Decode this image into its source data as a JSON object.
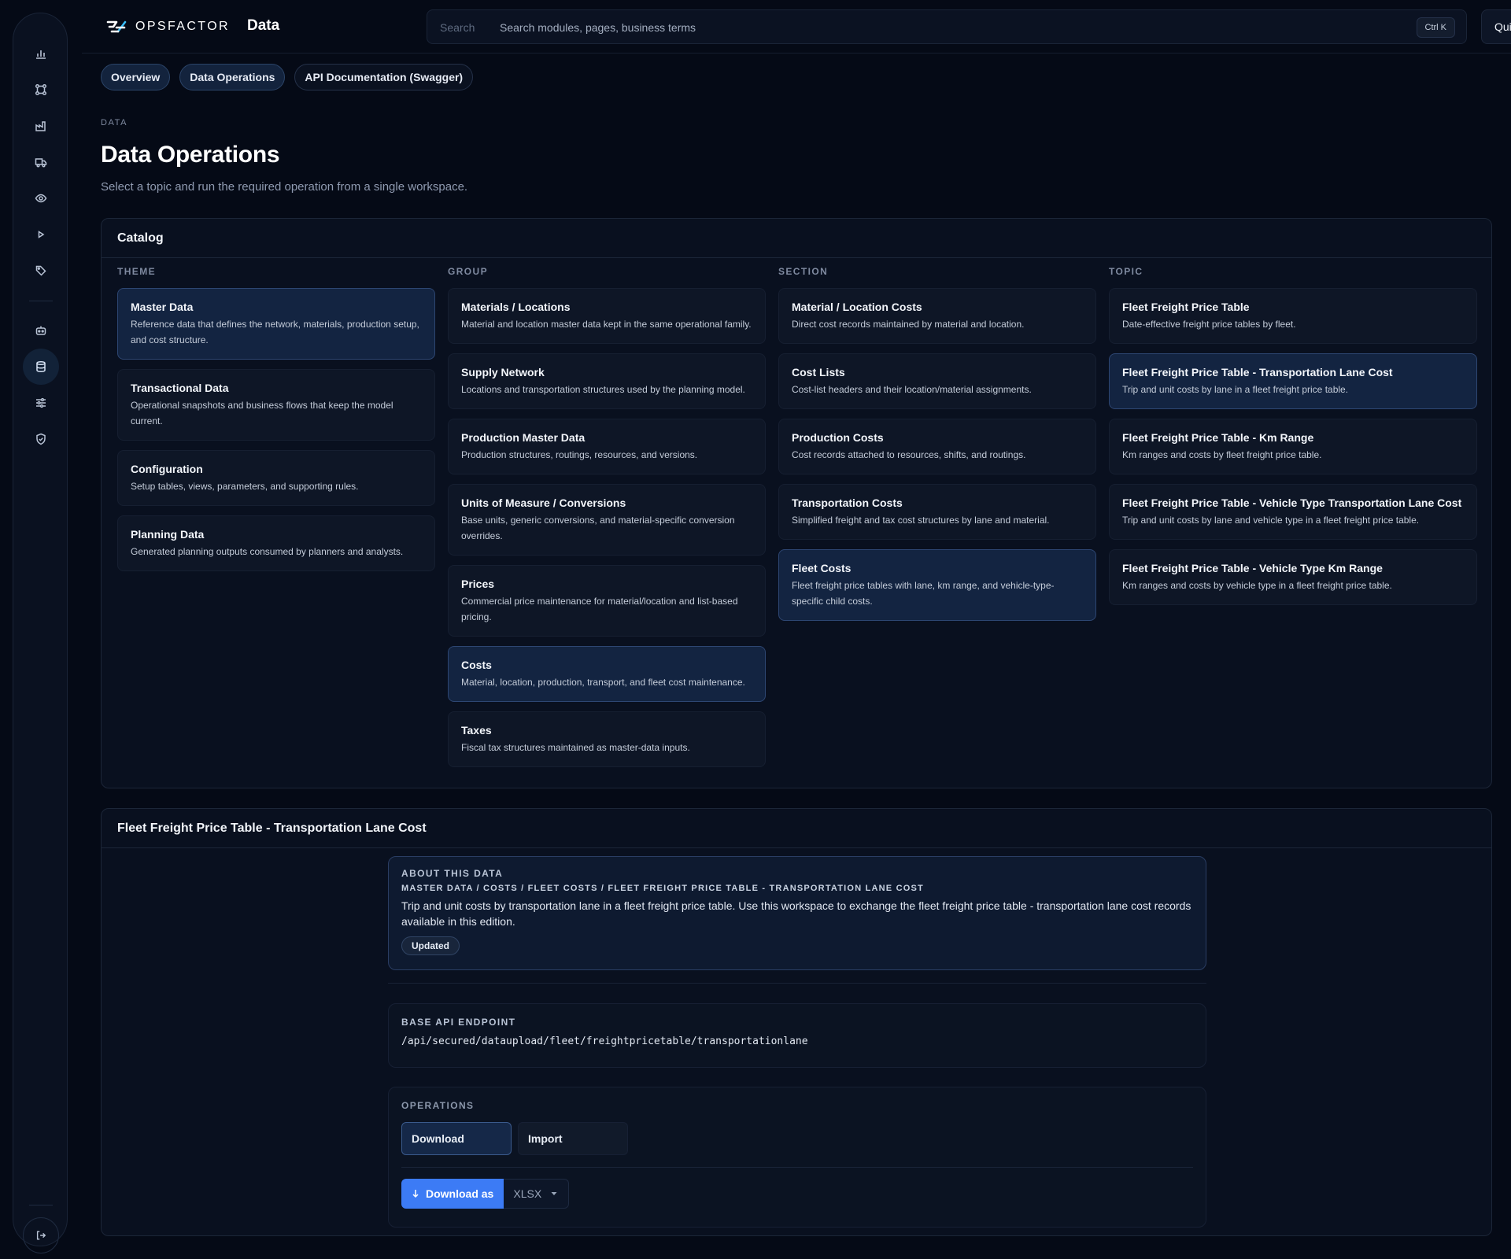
{
  "brand": {
    "name": "OPSFACTOR"
  },
  "header": {
    "title": "Data",
    "search_label": "Search",
    "search_placeholder": "Search modules, pages, business terms",
    "shortcut": "Ctrl K",
    "quick_actions": "Quick actions"
  },
  "sidebar": {
    "icons": [
      "bar-chart-icon",
      "network-icon",
      "factory-icon",
      "truck-icon",
      "eye-icon",
      "play-icon",
      "tag-icon",
      "robot-icon",
      "database-icon",
      "sliders-icon",
      "shield-icon"
    ],
    "active": "database-icon",
    "bottom_icon": "logout-icon"
  },
  "tabs": [
    {
      "label": "Overview",
      "active": true
    },
    {
      "label": "Data Operations",
      "active": true
    },
    {
      "label": "API Documentation (Swagger)",
      "active": false
    }
  ],
  "page": {
    "eyebrow": "DATA",
    "title": "Data Operations",
    "subtitle": "Select a topic and run the required operation from a single workspace."
  },
  "catalog": {
    "title": "Catalog",
    "columns": [
      {
        "header": "THEME",
        "items": [
          {
            "title": "Master Data",
            "desc": "Reference data that defines the network, materials, production setup, and cost structure.",
            "selected": true
          },
          {
            "title": "Transactional Data",
            "desc": "Operational snapshots and business flows that keep the model current.",
            "selected": false
          },
          {
            "title": "Configuration",
            "desc": "Setup tables, views, parameters, and supporting rules.",
            "selected": false
          },
          {
            "title": "Planning Data",
            "desc": "Generated planning outputs consumed by planners and analysts.",
            "selected": false
          }
        ]
      },
      {
        "header": "GROUP",
        "items": [
          {
            "title": "Materials / Locations",
            "desc": "Material and location master data kept in the same operational family.",
            "selected": false
          },
          {
            "title": "Supply Network",
            "desc": "Locations and transportation structures used by the planning model.",
            "selected": false
          },
          {
            "title": "Production Master Data",
            "desc": "Production structures, routings, resources, and versions.",
            "selected": false
          },
          {
            "title": "Units of Measure / Conversions",
            "desc": "Base units, generic conversions, and material-specific conversion overrides.",
            "selected": false
          },
          {
            "title": "Prices",
            "desc": "Commercial price maintenance for material/location and list-based pricing.",
            "selected": false
          },
          {
            "title": "Costs",
            "desc": "Material, location, production, transport, and fleet cost maintenance.",
            "selected": true
          },
          {
            "title": "Taxes",
            "desc": "Fiscal tax structures maintained as master-data inputs.",
            "selected": false
          }
        ]
      },
      {
        "header": "SECTION",
        "items": [
          {
            "title": "Material / Location Costs",
            "desc": "Direct cost records maintained by material and location.",
            "selected": false
          },
          {
            "title": "Cost Lists",
            "desc": "Cost-list headers and their location/material assignments.",
            "selected": false
          },
          {
            "title": "Production Costs",
            "desc": "Cost records attached to resources, shifts, and routings.",
            "selected": false
          },
          {
            "title": "Transportation Costs",
            "desc": "Simplified freight and tax cost structures by lane and material.",
            "selected": false
          },
          {
            "title": "Fleet Costs",
            "desc": "Fleet freight price tables with lane, km range, and vehicle-type-specific child costs.",
            "selected": true
          }
        ]
      },
      {
        "header": "TOPIC",
        "items": [
          {
            "title": "Fleet Freight Price Table",
            "desc": "Date-effective freight price tables by fleet.",
            "selected": false
          },
          {
            "title": "Fleet Freight Price Table - Transportation Lane Cost",
            "desc": "Trip and unit costs by lane in a fleet freight price table.",
            "selected": true
          },
          {
            "title": "Fleet Freight Price Table - Km Range",
            "desc": "Km ranges and costs by fleet freight price table.",
            "selected": false
          },
          {
            "title": "Fleet Freight Price Table - Vehicle Type Transportation Lane Cost",
            "desc": "Trip and unit costs by lane and vehicle type in a fleet freight price table.",
            "selected": false
          },
          {
            "title": "Fleet Freight Price Table - Vehicle Type Km Range",
            "desc": "Km ranges and costs by vehicle type in a fleet freight price table.",
            "selected": false
          }
        ]
      }
    ]
  },
  "detail": {
    "title": "Fleet Freight Price Table - Transportation Lane Cost",
    "about_label": "ABOUT THIS DATA",
    "path": "MASTER DATA / COSTS / FLEET COSTS / FLEET FREIGHT PRICE TABLE - TRANSPORTATION LANE COST",
    "description": "Trip and unit costs by transportation lane in a fleet freight price table. Use this workspace to exchange the fleet freight price table - transportation lane cost records available in this edition.",
    "badge": "Updated",
    "endpoint_label": "BASE API ENDPOINT",
    "endpoint": "/api/secured/dataupload/fleet/freightpricetable/transportationlane",
    "operations_label": "OPERATIONS",
    "operations": [
      {
        "label": "Download",
        "active": true
      },
      {
        "label": "Import",
        "active": false
      }
    ],
    "download_button": "Download as",
    "format": "XLSX"
  },
  "colors": {
    "accent": "#3c7bf5",
    "selected_card": "#132441",
    "background": "#050a16"
  }
}
